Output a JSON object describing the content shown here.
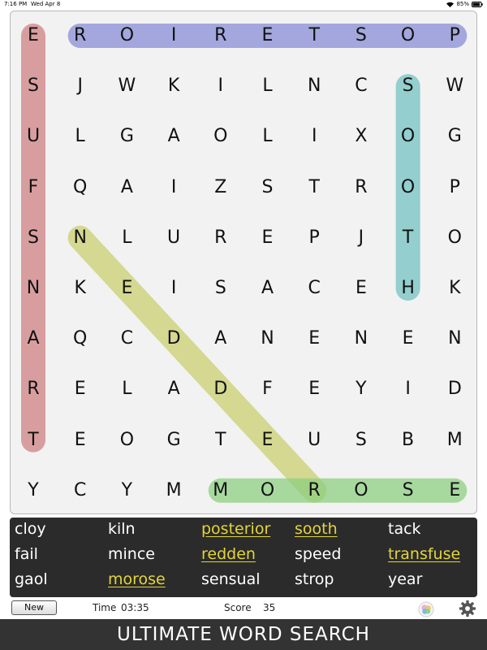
{
  "status": {
    "time": "7:16 PM",
    "date": "Wed Apr 8",
    "battery": "85%"
  },
  "grid": [
    [
      "E",
      "R",
      "O",
      "I",
      "R",
      "E",
      "T",
      "S",
      "O",
      "P"
    ],
    [
      "S",
      "J",
      "W",
      "K",
      "I",
      "L",
      "N",
      "C",
      "S",
      "W"
    ],
    [
      "U",
      "L",
      "G",
      "A",
      "O",
      "L",
      "I",
      "X",
      "O",
      "G"
    ],
    [
      "F",
      "Q",
      "A",
      "I",
      "Z",
      "S",
      "T",
      "R",
      "O",
      "P"
    ],
    [
      "S",
      "N",
      "L",
      "U",
      "R",
      "E",
      "P",
      "J",
      "T",
      "O"
    ],
    [
      "N",
      "K",
      "E",
      "I",
      "S",
      "A",
      "C",
      "E",
      "H",
      "K"
    ],
    [
      "A",
      "Q",
      "C",
      "D",
      "A",
      "N",
      "E",
      "N",
      "E",
      "N"
    ],
    [
      "R",
      "E",
      "L",
      "A",
      "D",
      "F",
      "E",
      "Y",
      "I",
      "D"
    ],
    [
      "T",
      "E",
      "O",
      "G",
      "T",
      "E",
      "U",
      "S",
      "B",
      "M"
    ],
    [
      "Y",
      "C",
      "Y",
      "M",
      "M",
      "O",
      "R",
      "O",
      "S",
      "E"
    ]
  ],
  "highlights": [
    {
      "word": "posterior",
      "color": "#8a8ed6",
      "from": [
        0,
        9
      ],
      "to": [
        0,
        1
      ]
    },
    {
      "word": "transfuse",
      "color": "#cf8183",
      "from": [
        8,
        0
      ],
      "to": [
        0,
        0
      ]
    },
    {
      "word": "sooth",
      "color": "#74c2c2",
      "from": [
        1,
        8
      ],
      "to": [
        5,
        8
      ]
    },
    {
      "word": "redden",
      "color": "#c9cf6f",
      "from": [
        9,
        6
      ],
      "to": [
        4,
        1
      ]
    },
    {
      "word": "morose",
      "color": "#8dcf82",
      "from": [
        9,
        4
      ],
      "to": [
        9,
        9
      ]
    }
  ],
  "words": [
    {
      "text": "cloy",
      "found": false
    },
    {
      "text": "fail",
      "found": false
    },
    {
      "text": "gaol",
      "found": false
    },
    {
      "text": "kiln",
      "found": false
    },
    {
      "text": "mince",
      "found": false
    },
    {
      "text": "morose",
      "found": true
    },
    {
      "text": "posterior",
      "found": true
    },
    {
      "text": "redden",
      "found": true
    },
    {
      "text": "sensual",
      "found": false
    },
    {
      "text": "sooth",
      "found": true
    },
    {
      "text": "speed",
      "found": false
    },
    {
      "text": "strop",
      "found": false
    },
    {
      "text": "tack",
      "found": false
    },
    {
      "text": "transfuse",
      "found": true
    },
    {
      "text": "year",
      "found": false
    }
  ],
  "info": {
    "new_label": "New",
    "time_label": "Time",
    "time_value": "03:35",
    "score_label": "Score",
    "score_value": "35"
  },
  "icons": {
    "wifi": "wifi-icon",
    "battery": "battery-icon",
    "game_center": "gamecenter-icon",
    "settings": "gear-icon"
  },
  "footer": {
    "title": "ULTIMATE WORD SEARCH"
  }
}
